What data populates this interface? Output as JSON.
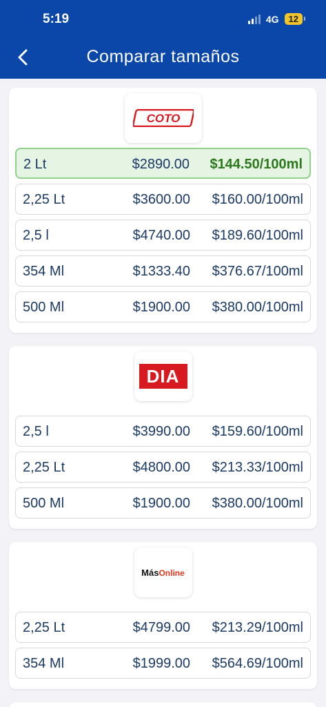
{
  "status": {
    "time": "5:19",
    "network": "4G",
    "battery": "12"
  },
  "header": {
    "title": "Comparar tamaños"
  },
  "stores": [
    {
      "logo_text": "COTO",
      "rows": [
        {
          "size": "2 Lt",
          "price": "$2890.00",
          "unit_price": "$144.50/100ml",
          "best": true
        },
        {
          "size": "2,25 Lt",
          "price": "$3600.00",
          "unit_price": "$160.00/100ml"
        },
        {
          "size": "2,5 l",
          "price": "$4740.00",
          "unit_price": "$189.60/100ml"
        },
        {
          "size": "354 Ml",
          "price": "$1333.40",
          "unit_price": "$376.67/100ml"
        },
        {
          "size": "500 Ml",
          "price": "$1900.00",
          "unit_price": "$380.00/100ml"
        }
      ]
    },
    {
      "logo_text": "DIA",
      "rows": [
        {
          "size": "2,5 l",
          "price": "$3990.00",
          "unit_price": "$159.60/100ml"
        },
        {
          "size": "2,25 Lt",
          "price": "$4800.00",
          "unit_price": "$213.33/100ml"
        },
        {
          "size": "500 Ml",
          "price": "$1900.00",
          "unit_price": "$380.00/100ml"
        }
      ]
    },
    {
      "logo_text_main": "Más",
      "logo_text_accent": "Online",
      "rows": [
        {
          "size": "2,25 Lt",
          "price": "$4799.00",
          "unit_price": "$213.29/100ml"
        },
        {
          "size": "354 Ml",
          "price": "$1999.00",
          "unit_price": "$564.69/100ml"
        }
      ]
    }
  ],
  "colors": {
    "header": "#0a47a8",
    "best_bg": "#e6f4e4",
    "best_text": "#2c7a1d",
    "row_text": "#1b3a66"
  }
}
